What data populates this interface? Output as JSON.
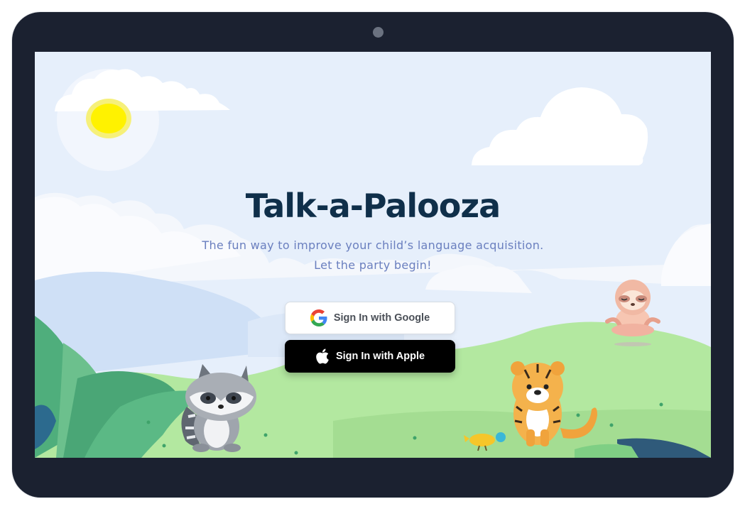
{
  "app": {
    "title": "Talk-a-Palooza",
    "tagline_line1": "The fun way to improve your child’s language acquisition.",
    "tagline_line2": "Let the party begin!"
  },
  "auth": {
    "google_label": "Sign In with Google",
    "apple_label": "Sign In with Apple"
  },
  "icons": {
    "google": "google-logo-icon",
    "apple": "apple-logo-icon",
    "camera": "camera-icon"
  },
  "colors": {
    "device_frame": "#1b2130",
    "sky": "#e5effb",
    "title": "#0f2f4a",
    "tagline": "#6a7fbf",
    "apple_button": "#000000",
    "google_button": "#ffffff",
    "grass": "#a8e49a",
    "sun": "#fff200"
  }
}
